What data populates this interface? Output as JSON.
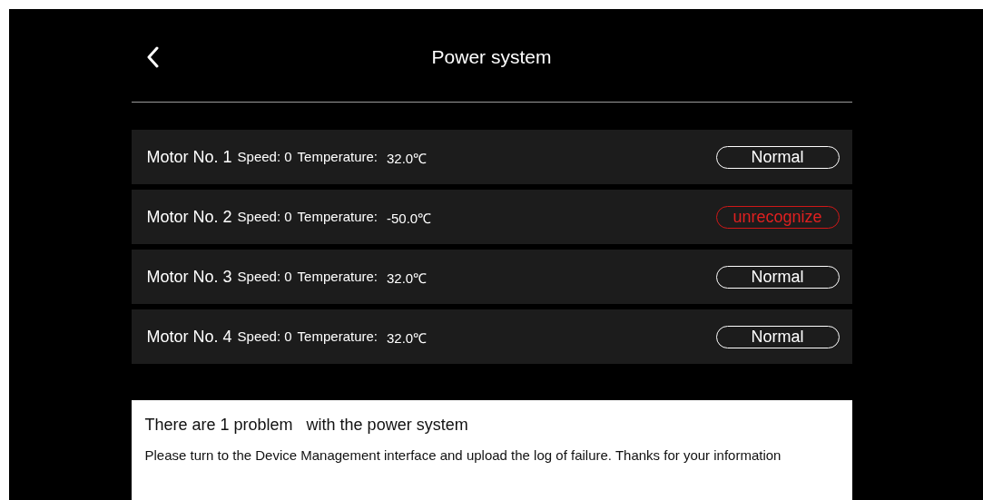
{
  "header": {
    "title": "Power system"
  },
  "motors": [
    {
      "name": "Motor No. 1",
      "speed": "Speed: 0",
      "temperature_label": "Temperature:",
      "temperature": "32.0℃",
      "status": "Normal",
      "kind": "normal"
    },
    {
      "name": "Motor No. 2",
      "speed": "Speed: 0",
      "temperature_label": "Temperature:",
      "temperature": "-50.0℃",
      "status": "unrecognize",
      "kind": "error"
    },
    {
      "name": "Motor No. 3",
      "speed": "Speed: 0",
      "temperature_label": "Temperature:",
      "temperature": "32.0℃",
      "status": "Normal",
      "kind": "normal"
    },
    {
      "name": "Motor No. 4",
      "speed": "Speed: 0",
      "temperature_label": "Temperature:",
      "temperature": "32.0℃",
      "status": "Normal",
      "kind": "normal"
    }
  ],
  "notice": {
    "title": "There are 1 problem   with the power system",
    "message": "Please turn to the Device Management interface and upload the log of failure. Thanks for your information"
  }
}
